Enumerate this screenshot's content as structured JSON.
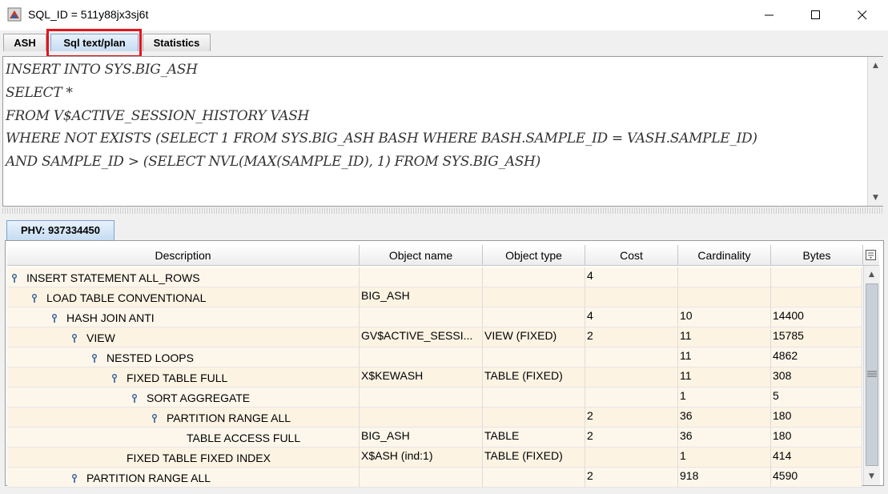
{
  "window": {
    "title": "SQL_ID = 511y88jx3sj6t"
  },
  "tabs": [
    {
      "label": "ASH"
    },
    {
      "label": "Sql text/plan"
    },
    {
      "label": "Statistics"
    }
  ],
  "sql_text": [
    "INSERT INTO SYS.BIG_ASH",
    "SELECT *",
    "FROM V$ACTIVE_SESSION_HISTORY VASH",
    "WHERE NOT EXISTS (SELECT 1 FROM SYS.BIG_ASH BASH WHERE BASH.SAMPLE_ID = VASH.SAMPLE_ID)",
    "AND SAMPLE_ID > (SELECT NVL(MAX(SAMPLE_ID), 1) FROM SYS.BIG_ASH)"
  ],
  "plan_tab": {
    "label": "PHV: 937334450"
  },
  "columns": [
    "Description",
    "Object name",
    "Object type",
    "Cost",
    "Cardinality",
    "Bytes"
  ],
  "rows": [
    {
      "depth": 0,
      "icon": true,
      "description": "INSERT STATEMENT  ALL_ROWS",
      "object_name": "",
      "object_type": "",
      "cost": "4",
      "cardinality": "",
      "bytes": ""
    },
    {
      "depth": 1,
      "icon": true,
      "description": "LOAD TABLE CONVENTIONAL",
      "object_name": "BIG_ASH",
      "object_type": "",
      "cost": "",
      "cardinality": "",
      "bytes": ""
    },
    {
      "depth": 2,
      "icon": true,
      "description": "HASH JOIN ANTI",
      "object_name": "",
      "object_type": "",
      "cost": "4",
      "cardinality": "10",
      "bytes": "14400"
    },
    {
      "depth": 3,
      "icon": true,
      "description": "VIEW",
      "object_name": "GV$ACTIVE_SESSI...",
      "object_type": "VIEW (FIXED)",
      "cost": "2",
      "cardinality": "11",
      "bytes": "15785"
    },
    {
      "depth": 4,
      "icon": true,
      "description": "NESTED LOOPS",
      "object_name": "",
      "object_type": "",
      "cost": "",
      "cardinality": "11",
      "bytes": "4862"
    },
    {
      "depth": 5,
      "icon": true,
      "description": "FIXED TABLE FULL",
      "object_name": "X$KEWASH",
      "object_type": "TABLE (FIXED)",
      "cost": "",
      "cardinality": "11",
      "bytes": "308"
    },
    {
      "depth": 6,
      "icon": true,
      "description": "SORT AGGREGATE",
      "object_name": "",
      "object_type": "",
      "cost": "",
      "cardinality": "1",
      "bytes": "5"
    },
    {
      "depth": 7,
      "icon": true,
      "description": "PARTITION RANGE ALL",
      "object_name": "",
      "object_type": "",
      "cost": "2",
      "cardinality": "36",
      "bytes": "180"
    },
    {
      "depth": 8,
      "icon": false,
      "description": "TABLE ACCESS FULL",
      "object_name": "BIG_ASH",
      "object_type": "TABLE",
      "cost": "2",
      "cardinality": "36",
      "bytes": "180"
    },
    {
      "depth": 5,
      "icon": false,
      "description": "FIXED TABLE FIXED INDEX",
      "object_name": "X$ASH (ind:1)",
      "object_type": "TABLE (FIXED)",
      "cost": "",
      "cardinality": "1",
      "bytes": "414"
    },
    {
      "depth": 3,
      "icon": true,
      "description": "PARTITION RANGE ALL",
      "object_name": "",
      "object_type": "",
      "cost": "2",
      "cardinality": "918",
      "bytes": "4590"
    }
  ]
}
